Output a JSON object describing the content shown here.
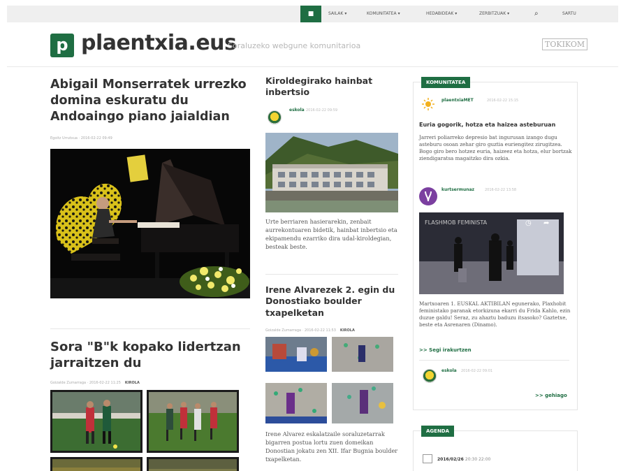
{
  "nav": {
    "items": [
      "Sailak",
      "Komunitatea",
      "Hedabideak",
      "Zerbitzuak"
    ],
    "login": "Sartu"
  },
  "header": {
    "logo_letter": "p",
    "site_name": "plaentxia.eus",
    "tagline": "Soraluzeko webgune komunitarioa",
    "partner": "TOKIKOM"
  },
  "left": {
    "article1": {
      "title": "Abigail Monserratek urrezko domina eskuratu du Andoaingo piano jaialdian",
      "meta": "Egoitz Urrutxua · 2016-02-22 09:49"
    },
    "article2": {
      "title": "Sora \"B\"k kopako lidertzan jarraitzen du",
      "meta": "Goizalde Zumarraga · 2016-02-22 11:25",
      "tag": "KIROLA"
    }
  },
  "middle": {
    "article1": {
      "title": "Kiroldegirako hainbat inbertsio",
      "user": "eskola",
      "date": "2016-02-22 09:59",
      "body": "Urte berriaren hasierarekin, zenbait aurrekontuaren bidetik, hainbat inbertsio eta ekipamendu ezarriko dira udal-kiroldegian, besteak beste."
    },
    "article2": {
      "title": "Irene Alvarezek 2. egin du Donostiako boulder txapelketan",
      "meta": "Goizalde Zumarraga · 2016-02-22 11:53",
      "tag": "KIROLA",
      "body": "Irene Alvarez eskalatzaile soraluzetarrak bigarren postua lortu zuen domeikan Donostian jokatu zen XII. Ifar Bugnia boulder txapelketan."
    }
  },
  "right": {
    "community": {
      "label": "Komunitatea",
      "post1_user": "plaentxiaMET",
      "post1_date": "2016-02-22 15:15",
      "post1_title": "Euria gogorik, hotza eta haizea asteburuan",
      "post1_text": "Jarreri poliarreko depresio bat ingurusan izango dugu asteburu osoan zehar giro guztia euriengitez zirugitzea. Bogo giro bero hotzez euria, haizeez eta hotza, elur bortzak ziendigaratsa magaitzko dira ozkia.",
      "post2_user": "kurtsermunaz",
      "post2_date": "2016-02-22 13:58",
      "video_title": "FLASHMOB FEMINISTA",
      "post2_text": "Martxoaren 1. EUSKAL AKTIBILAN egunerako, Plaxhobit feministako paranak etorkizuna ekarri du Frida Kahlo, ezin duzue galdu! Seraz, zu ahaztu baduzu itsasoko? Gaztetxe, beste eta Asrenaren (Dinamo).",
      "more_reading": ">> Segi irakurtzen",
      "post3_user": "eskola",
      "post3_date": "2016-02-22 09:01",
      "more": ">> gehiago"
    },
    "agenda": {
      "label": "Agenda",
      "date": "2016/02/26",
      "time": "20:30 22:00"
    }
  },
  "colors": {
    "brand": "#1f6e43"
  }
}
